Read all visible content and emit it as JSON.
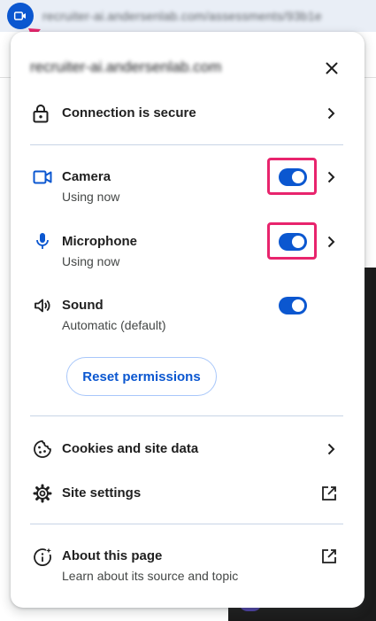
{
  "browser": {
    "url_blurred": "recruiter-ai.andersenlab.com/assessments/93b1e"
  },
  "popup": {
    "site_blurred": "recruiter-ai.andersenlab.com",
    "connection": {
      "label": "Connection is secure"
    },
    "camera": {
      "label": "Camera",
      "status": "Using now",
      "enabled": true
    },
    "microphone": {
      "label": "Microphone",
      "status": "Using now",
      "enabled": true
    },
    "sound": {
      "label": "Sound",
      "status": "Automatic (default)",
      "enabled": true
    },
    "reset_button": "Reset permissions",
    "cookies": {
      "label": "Cookies and site data"
    },
    "site_settings": {
      "label": "Site settings"
    },
    "about": {
      "label": "About this page",
      "sub": "Learn about its source and topic"
    }
  },
  "colors": {
    "accent": "#0b57d0",
    "highlight": "#e8246d",
    "separator": "#c8d4e6"
  }
}
